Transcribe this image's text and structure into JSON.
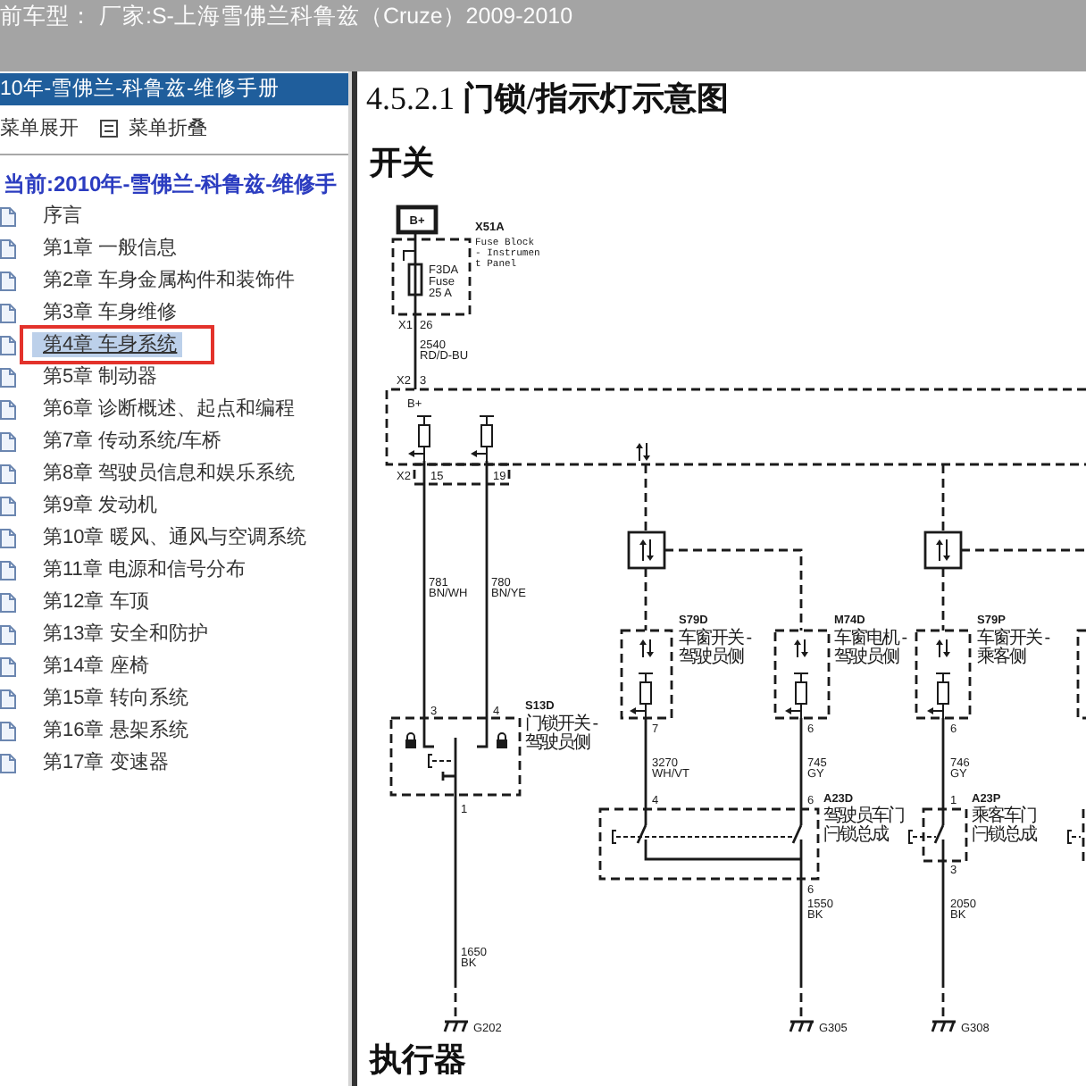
{
  "title_bar": {
    "text": "前车型： 厂家:S-上海雪佛兰科鲁兹（Cruze）2009-2010"
  },
  "sidebar": {
    "header": "10年-雪佛兰-科鲁兹-维修手册",
    "toolbar": [
      {
        "label": "菜单展开",
        "icon": false
      },
      {
        "label": "菜单折叠",
        "icon": true
      }
    ],
    "current": "当前:2010年-雪佛兰-科鲁兹-维修手",
    "items": [
      {
        "label": "序言",
        "selected": false,
        "marked": false
      },
      {
        "label": "第1章 一般信息",
        "selected": false,
        "marked": false
      },
      {
        "label": "第2章 车身金属构件和装饰件",
        "selected": false,
        "marked": false
      },
      {
        "label": "第3章 车身维修",
        "selected": false,
        "marked": false
      },
      {
        "label": "第4章 车身系统",
        "selected": true,
        "marked": true
      },
      {
        "label": "第5章 制动器",
        "selected": false,
        "marked": false
      },
      {
        "label": "第6章 诊断概述、起点和编程",
        "selected": false,
        "marked": false
      },
      {
        "label": "第7章 传动系统/车桥",
        "selected": false,
        "marked": false
      },
      {
        "label": "第8章 驾驶员信息和娱乐系统",
        "selected": false,
        "marked": false
      },
      {
        "label": "第9章 发动机",
        "selected": false,
        "marked": false
      },
      {
        "label": "第10章 暖风、通风与空调系统",
        "selected": false,
        "marked": false
      },
      {
        "label": "第11章 电源和信号分布",
        "selected": false,
        "marked": false
      },
      {
        "label": "第12章 车顶",
        "selected": false,
        "marked": false
      },
      {
        "label": "第13章 安全和防护",
        "selected": false,
        "marked": false
      },
      {
        "label": "第14章 座椅",
        "selected": false,
        "marked": false
      },
      {
        "label": "第15章 转向系统",
        "selected": false,
        "marked": false
      },
      {
        "label": "第16章 悬架系统",
        "selected": false,
        "marked": false
      },
      {
        "label": "第17章 变速器",
        "selected": false,
        "marked": false
      }
    ]
  },
  "document": {
    "heading": "4.5.2.1 **门锁/指示灯示意图**",
    "sections": [
      {
        "title": "开关",
        "diagram": {
          "terminal": "B+",
          "fuse_block": {
            "code": "X51A",
            "description": [
              "Fuse Block",
              "- Instrumen",
              "t Panel"
            ],
            "fuse": [
              "F3DA",
              "Fuse",
              "25 A"
            ]
          },
          "connectors": [
            {
              "code": "X1",
              "pins": [
                "26"
              ]
            },
            {
              "code": "X2",
              "pins": [
                "3"
              ]
            },
            {
              "code": "X2",
              "pins": [
                "15",
                "19"
              ]
            }
          ],
          "module_label": "B+",
          "wires": [
            {
              "circuit": "2540",
              "color_code": "RD/D-BU"
            },
            {
              "circuit": "781",
              "color_code": "BN/WH"
            },
            {
              "circuit": "780",
              "color_code": "BN/YE"
            },
            {
              "circuit": "3270",
              "color_code": "WH/VT"
            },
            {
              "circuit": "745",
              "color_code": "GY"
            },
            {
              "circuit": "746",
              "color_code": "GY"
            },
            {
              "circuit": "1650",
              "color_code": "BK"
            },
            {
              "circuit": "1550",
              "color_code": "BK"
            },
            {
              "circuit": "2050",
              "color_code": "BK"
            }
          ],
          "components": [
            {
              "code": "S13D",
              "description": [
                "门锁开关 -",
                "驾驶员侧"
              ],
              "pins": [
                "3",
                "4",
                "1"
              ]
            },
            {
              "code": "S79D",
              "description": [
                "车窗开关 -",
                "驾驶员侧"
              ],
              "pins": [
                "7"
              ]
            },
            {
              "code": "M74D",
              "description": [
                "车窗电机 -",
                "驾驶员侧"
              ],
              "pins": [
                "6"
              ]
            },
            {
              "code": "A23D",
              "description": [
                "驾驶员车门",
                "闩锁总成"
              ],
              "pins": [
                "4",
                "6",
                "6"
              ]
            },
            {
              "code": "S79P",
              "description": [
                "车窗开关 -",
                "乘客侧"
              ],
              "pins": [
                "6"
              ]
            },
            {
              "code": "A23P",
              "description": [
                "乘客车门",
                "闩锁总成"
              ],
              "pins": [
                "1",
                "3"
              ]
            }
          ],
          "grounds": [
            "G202",
            "G305",
            "G308"
          ]
        }
      },
      {
        "title": "执行器"
      }
    ]
  }
}
